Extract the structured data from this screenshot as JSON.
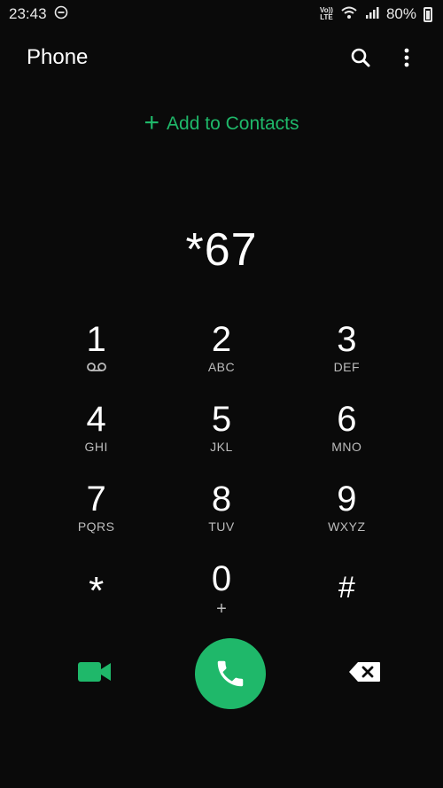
{
  "status_bar": {
    "time": "23:43",
    "volte_top": "Vo))",
    "volte_bottom": "LTE",
    "battery": "80%"
  },
  "app_bar": {
    "title": "Phone",
    "icons": [
      "search-icon",
      "more-vert-icon"
    ]
  },
  "add_contacts": {
    "label": "Add to Contacts"
  },
  "dialer": {
    "number": "*67"
  },
  "keypad": {
    "keys": [
      {
        "digit": "1",
        "letters": ""
      },
      {
        "digit": "2",
        "letters": "ABC"
      },
      {
        "digit": "3",
        "letters": "DEF"
      },
      {
        "digit": "4",
        "letters": "GHI"
      },
      {
        "digit": "5",
        "letters": "JKL"
      },
      {
        "digit": "6",
        "letters": "MNO"
      },
      {
        "digit": "7",
        "letters": "PQRS"
      },
      {
        "digit": "8",
        "letters": "TUV"
      },
      {
        "digit": "9",
        "letters": "WXYZ"
      },
      {
        "digit": "*",
        "letters": ""
      },
      {
        "digit": "0",
        "letters": "+"
      },
      {
        "digit": "#",
        "letters": ""
      }
    ]
  },
  "colors": {
    "accent": "#1fb86a",
    "background": "#0a0a0a",
    "text": "#ffffff",
    "subtext": "#bdbdbd"
  }
}
